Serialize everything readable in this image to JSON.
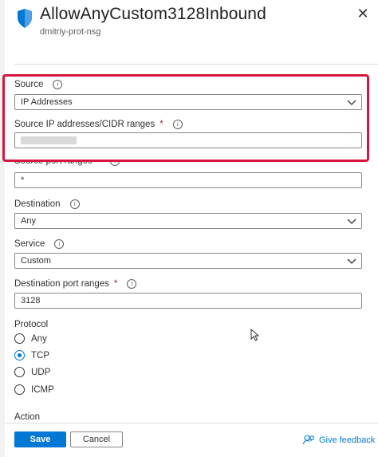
{
  "header": {
    "title": "AllowAnyCustom3128Inbound",
    "subtitle": "dmitriy-prot-nsg"
  },
  "form": {
    "source": {
      "label": "Source",
      "value": "IP Addresses"
    },
    "source_ip": {
      "label": "Source IP addresses/CIDR ranges",
      "required_mark": "*"
    },
    "source_port": {
      "label": "Source port ranges",
      "required_mark": "*",
      "value": "*"
    },
    "destination": {
      "label": "Destination",
      "value": "Any"
    },
    "service": {
      "label": "Service",
      "value": "Custom"
    },
    "destination_port": {
      "label": "Destination port ranges",
      "required_mark": "*",
      "value": "3128"
    },
    "protocol": {
      "label": "Protocol",
      "options": [
        "Any",
        "TCP",
        "UDP",
        "ICMP"
      ],
      "selected": "TCP"
    },
    "action": {
      "label": "Action"
    }
  },
  "footer": {
    "save_label": "Save",
    "cancel_label": "Cancel",
    "feedback_label": "Give feedback"
  },
  "colors": {
    "accent": "#0078d4",
    "highlight": "#d6163f"
  },
  "icons": {
    "shield": "shield-icon",
    "close": "close-icon",
    "info": "info-icon",
    "chevron": "chevron-down-icon",
    "feedback": "feedback-icon"
  }
}
